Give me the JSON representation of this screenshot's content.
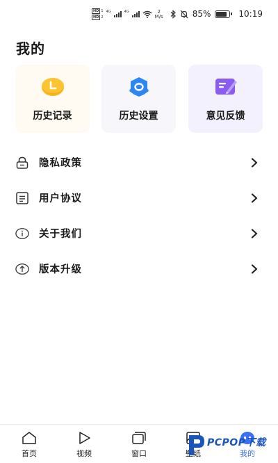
{
  "status_bar": {
    "hd1": "HD",
    "hd2": "HD",
    "net1": "4G",
    "net2": "4G",
    "speed_value": "2",
    "speed_unit": "M/s",
    "battery": "85%",
    "time": "10:19"
  },
  "page": {
    "title": "我的"
  },
  "cards": [
    {
      "label": "历史记录",
      "icon": "clock-icon",
      "color": "#f5b516"
    },
    {
      "label": "历史设置",
      "icon": "gear-icon",
      "color": "#2e86f0"
    },
    {
      "label": "意见反馈",
      "icon": "feedback-icon",
      "color": "#8a5cf0"
    }
  ],
  "menu": [
    {
      "label": "隐私政策",
      "icon": "lock-icon"
    },
    {
      "label": "用户协议",
      "icon": "document-icon"
    },
    {
      "label": "关于我们",
      "icon": "info-icon"
    },
    {
      "label": "版本升级",
      "icon": "upgrade-icon"
    }
  ],
  "bottom_nav": [
    {
      "label": "首页",
      "icon": "home-icon"
    },
    {
      "label": "视频",
      "icon": "play-icon"
    },
    {
      "label": "窗口",
      "icon": "window-icon"
    },
    {
      "label": "壁纸",
      "icon": "wallpaper-icon"
    },
    {
      "label": "我的",
      "icon": "profile-icon",
      "active": true
    }
  ],
  "watermark": {
    "brand": "PCPOP下载"
  },
  "colors": {
    "accent": "#3b6ff5"
  }
}
